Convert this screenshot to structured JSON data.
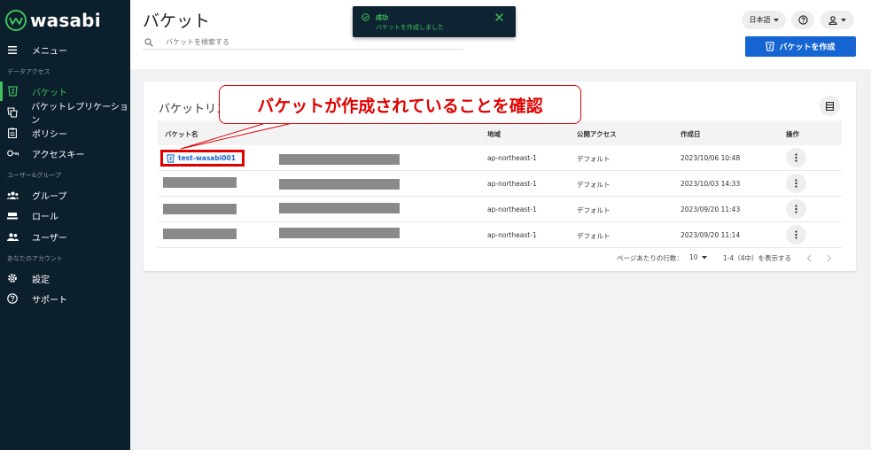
{
  "brand": {
    "name": "wasabi"
  },
  "sidebar": {
    "menu": "メニュー",
    "sections": {
      "data_access": "データアクセス",
      "users_groups": "ユーザー&グループ",
      "your_account": "あなたのアカウント"
    },
    "items": [
      {
        "label": "バケット",
        "icon": "bucket-icon",
        "active": true
      },
      {
        "label": "バケットレプリケーション",
        "icon": "replication-icon",
        "active": false
      },
      {
        "label": "ポリシー",
        "icon": "policy-icon",
        "active": false
      },
      {
        "label": "アクセスキー",
        "icon": "key-icon",
        "active": false
      },
      {
        "label": "グループ",
        "icon": "group-icon",
        "active": false
      },
      {
        "label": "ロール",
        "icon": "role-icon",
        "active": false
      },
      {
        "label": "ユーザー",
        "icon": "users-icon",
        "active": false
      },
      {
        "label": "設定",
        "icon": "gear-icon",
        "active": false
      },
      {
        "label": "サポート",
        "icon": "help-icon",
        "active": false
      }
    ]
  },
  "header": {
    "title": "バケット",
    "search_placeholder": "バケットを検索する",
    "language": "日本語",
    "create_button": "バケットを作成"
  },
  "toast": {
    "title": "成功",
    "message": "バケットを作成しました"
  },
  "list": {
    "title": "バケットリスト",
    "columns": [
      "バケット名",
      "地域",
      "公開アクセス",
      "作成日",
      "操作"
    ],
    "rows": [
      {
        "name": "test-wasabi001",
        "region": "ap-northeast-1",
        "access": "デフォルト",
        "created": "2023/10/06 10:48"
      },
      {
        "name": "",
        "region": "ap-northeast-1",
        "access": "デフォルト",
        "created": "2023/10/03 14:33"
      },
      {
        "name": "",
        "region": "ap-northeast-1",
        "access": "デフォルト",
        "created": "2023/09/20 11:43"
      },
      {
        "name": "",
        "region": "ap-northeast-1",
        "access": "デフォルト",
        "created": "2023/09/20 11:14"
      }
    ],
    "pagination": {
      "rows_per_page_label": "ページあたりの行数：",
      "rows_per_page": "10",
      "range": "1-4（4中）を表示する"
    }
  },
  "callout": {
    "text": "バケットが作成されていることを確認"
  },
  "colors": {
    "sidebar_bg": "#0c1f2c",
    "accent_green": "#3fc25a",
    "primary_blue": "#1464d2",
    "highlight_red": "#e00000"
  }
}
